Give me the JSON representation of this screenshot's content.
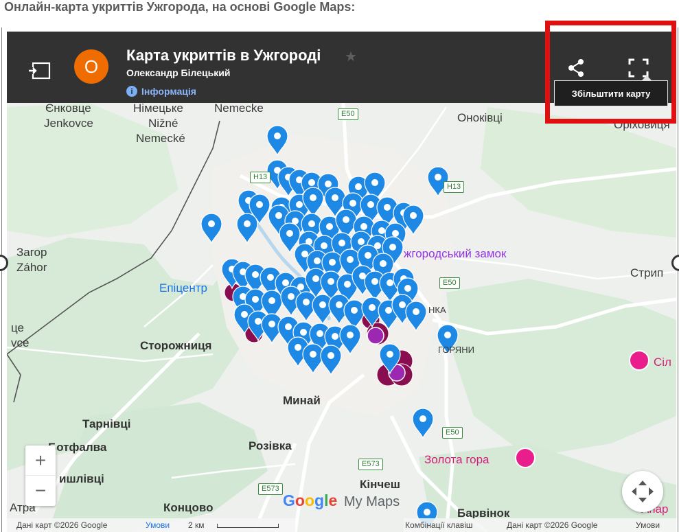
{
  "page": {
    "heading": "Онлайн-карта укриттів Ужгорода, на основі Google Maps:"
  },
  "header": {
    "avatar_letter": "О",
    "title": "Карта укриттів в Ужгороді",
    "star_glyph": "★",
    "author": "Олександр Білецький",
    "info_label": "Інформація",
    "tooltip": "Збільштити карту"
  },
  "places": {
    "enkovce": "Єнковце",
    "jenkovce": "Jenkovce",
    "nimecke": "Німецьке",
    "nizne": "Nižné",
    "nemecke": "Nemecké",
    "nemecke_top": "Nemecke",
    "onokivtsi": "Оноківці",
    "orikhovytsia": "Оріховиця",
    "zahor": "Загор",
    "zahor_lat": "Záhor",
    "zamok": "жгородський замок",
    "epicentr": "Епіцентр",
    "stryp": "Стрип",
    "nka": "НКА",
    "goriany": "ГОРЯНИ",
    "left_ce": "це",
    "left_vce": "vce",
    "storozhnytsia": "Сторожниця",
    "si": "Сіл",
    "mynai": "Минай",
    "tarnivtsi": "Тарнівці",
    "botfalva": "Ботфалва",
    "rozivka": "Розівка",
    "zolota_hora": "Золота гора",
    "shlivtsi": "ишлівці",
    "kinchesh": "Кінчеш",
    "katsa": "Атра",
    "kontsovo": "Концово",
    "barvinok": "Барвінок",
    "apar": "Апар"
  },
  "roads": {
    "e50": "E50",
    "h13": "H13",
    "e573": "E573"
  },
  "controls": {
    "zoom_in": "+",
    "zoom_out": "−"
  },
  "logo": {
    "g1": "G",
    "o1": "o",
    "o2": "o",
    "g2": "g",
    "l": "l",
    "e": "e",
    "mymaps": "My Maps"
  },
  "footer": {
    "data_left": "Дані карт ©2026 Google",
    "terms": "Умови",
    "scale": "2 км",
    "shortcuts": "Комбінації клавіш",
    "data_right": "Дані карт ©2026 Google",
    "terms_right": "Умови"
  },
  "colors": {
    "header_bg": "#323232",
    "avatar": "#ef6c00",
    "pin_blue": "#1e88e5",
    "pin_maroon": "#880e4f",
    "highlight": "#e01010",
    "road": "#ffffff"
  }
}
